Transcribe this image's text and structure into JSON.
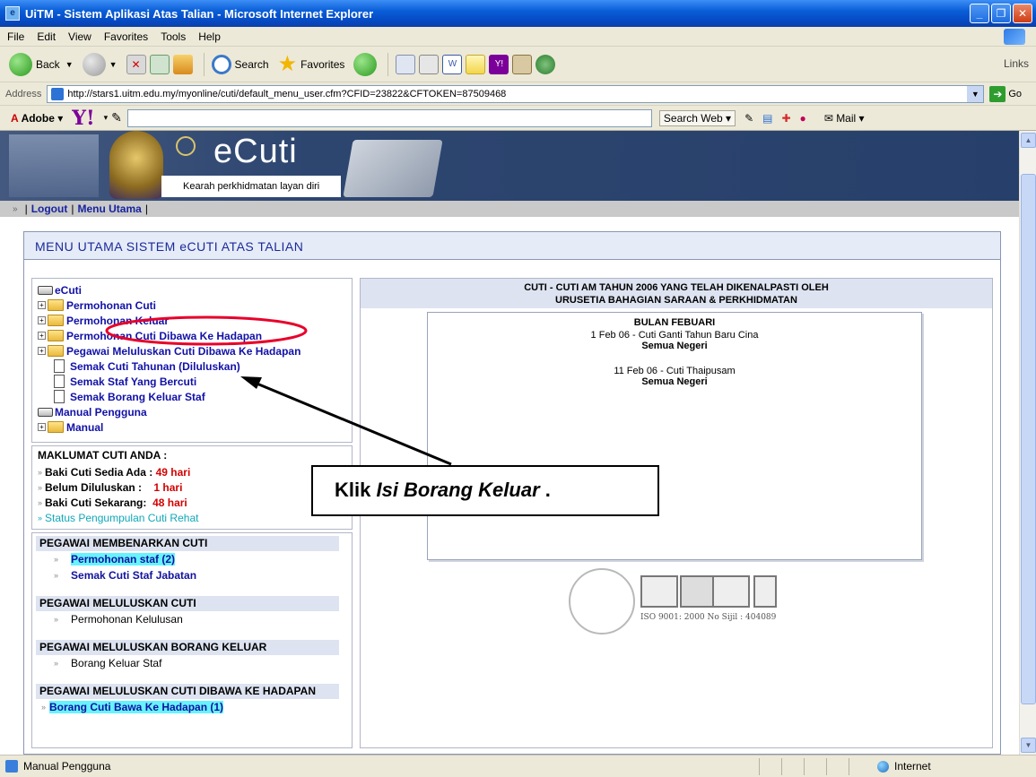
{
  "window": {
    "title": "UiTM - Sistem Aplikasi Atas Talian - Microsoft Internet Explorer",
    "buttons": [
      "_",
      "❐",
      "✕"
    ]
  },
  "menu": [
    "File",
    "Edit",
    "View",
    "Favorites",
    "Tools",
    "Help"
  ],
  "toolbar": {
    "back": "Back",
    "search": "Search",
    "favorites": "Favorites",
    "links": "Links"
  },
  "address": {
    "label": "Address",
    "url": "http://stars1.uitm.edu.my/myonline/cuti/default_menu_user.cfm?CFID=23822&CFTOKEN=87509468",
    "go": "Go"
  },
  "yahoobar": {
    "adobe": "Adobe",
    "yahoo": "Y!",
    "search_web": "Search Web",
    "mail": "Mail"
  },
  "site": {
    "title": "eCuti",
    "tagline": "Kearah perkhidmatan layan diri",
    "nav": [
      "Logout",
      "Menu Utama"
    ]
  },
  "main_heading": "MENU UTAMA SISTEM eCUTI ATAS TALIAN",
  "tree": [
    {
      "label": "eCuti",
      "kind": "drive"
    },
    {
      "label": "Permohonan Cuti",
      "kind": "folder"
    },
    {
      "label": "Permohonan Keluar",
      "kind": "folder"
    },
    {
      "label": "Permohonan Cuti Dibawa Ke Hadapan",
      "kind": "folder"
    },
    {
      "label": "Pegawai Meluluskan Cuti Dibawa Ke Hadapan",
      "kind": "folder"
    },
    {
      "label": "Semak Cuti Tahunan (Diluluskan)",
      "kind": "doc"
    },
    {
      "label": "Semak Staf Yang Bercuti",
      "kind": "doc"
    },
    {
      "label": "Semak Borang Keluar Staf",
      "kind": "doc"
    },
    {
      "label": "Manual Pengguna",
      "kind": "drive"
    },
    {
      "label": "Manual",
      "kind": "folder"
    }
  ],
  "info": {
    "heading": "MAKLUMAT CUTI ANDA :",
    "rows": [
      {
        "label": "Baki Cuti Sedia Ada :",
        "value": "49 hari"
      },
      {
        "label": "Belum Diluluskan :",
        "value": "1 hari"
      },
      {
        "label": "Baki Cuti Sekarang:",
        "value": "48 hari"
      }
    ],
    "status_link": "Status Pengumpulan Cuti Rehat"
  },
  "officer": {
    "sections": [
      {
        "heading": "PEGAWAI MEMBENARKAN CUTI",
        "items": [
          "Permohonan staf (2)",
          "Semak Cuti Staf Jabatan"
        ]
      },
      {
        "heading": "PEGAWAI MELULUSKAN CUTI",
        "items": [
          "Permohonan Kelulusan"
        ]
      },
      {
        "heading": "PEGAWAI MELULUSKAN BORANG KELUAR",
        "items": [
          "Borang Keluar Staf"
        ]
      },
      {
        "heading": "PEGAWAI MELULUSKAN CUTI DIBAWA KE HADAPAN",
        "items": [
          "Borang Cuti Bawa Ke Hadapan  (1)"
        ]
      }
    ]
  },
  "holidays": {
    "heading_line1": "CUTI - CUTI AM TAHUN 2006 YANG TELAH DIKENALPASTI OLEH",
    "heading_line2": "URUSETIA BAHAGIAN SARAAN & PERKHIDMATAN",
    "month": "BULAN FEBUARI",
    "entries": [
      {
        "text": "1 Feb 06 - Cuti Ganti Tahun Baru Cina",
        "states": "Semua Negeri"
      },
      {
        "text": "11 Feb 06 - Cuti Thaipusam",
        "states": "Semua Negeri"
      }
    ],
    "iso": "ISO 9001: 2000  No Sijil : 404089"
  },
  "callout": {
    "prefix": "Klik ",
    "italic": "Isi Borang Keluar",
    "suffix": " ."
  },
  "status": {
    "text": "Manual Pengguna",
    "zone": "Internet"
  },
  "colors": {
    "link": "#1111a7",
    "red_value": "#d40000",
    "highlight": "#66f3ff",
    "header_blue": "#27406b"
  }
}
